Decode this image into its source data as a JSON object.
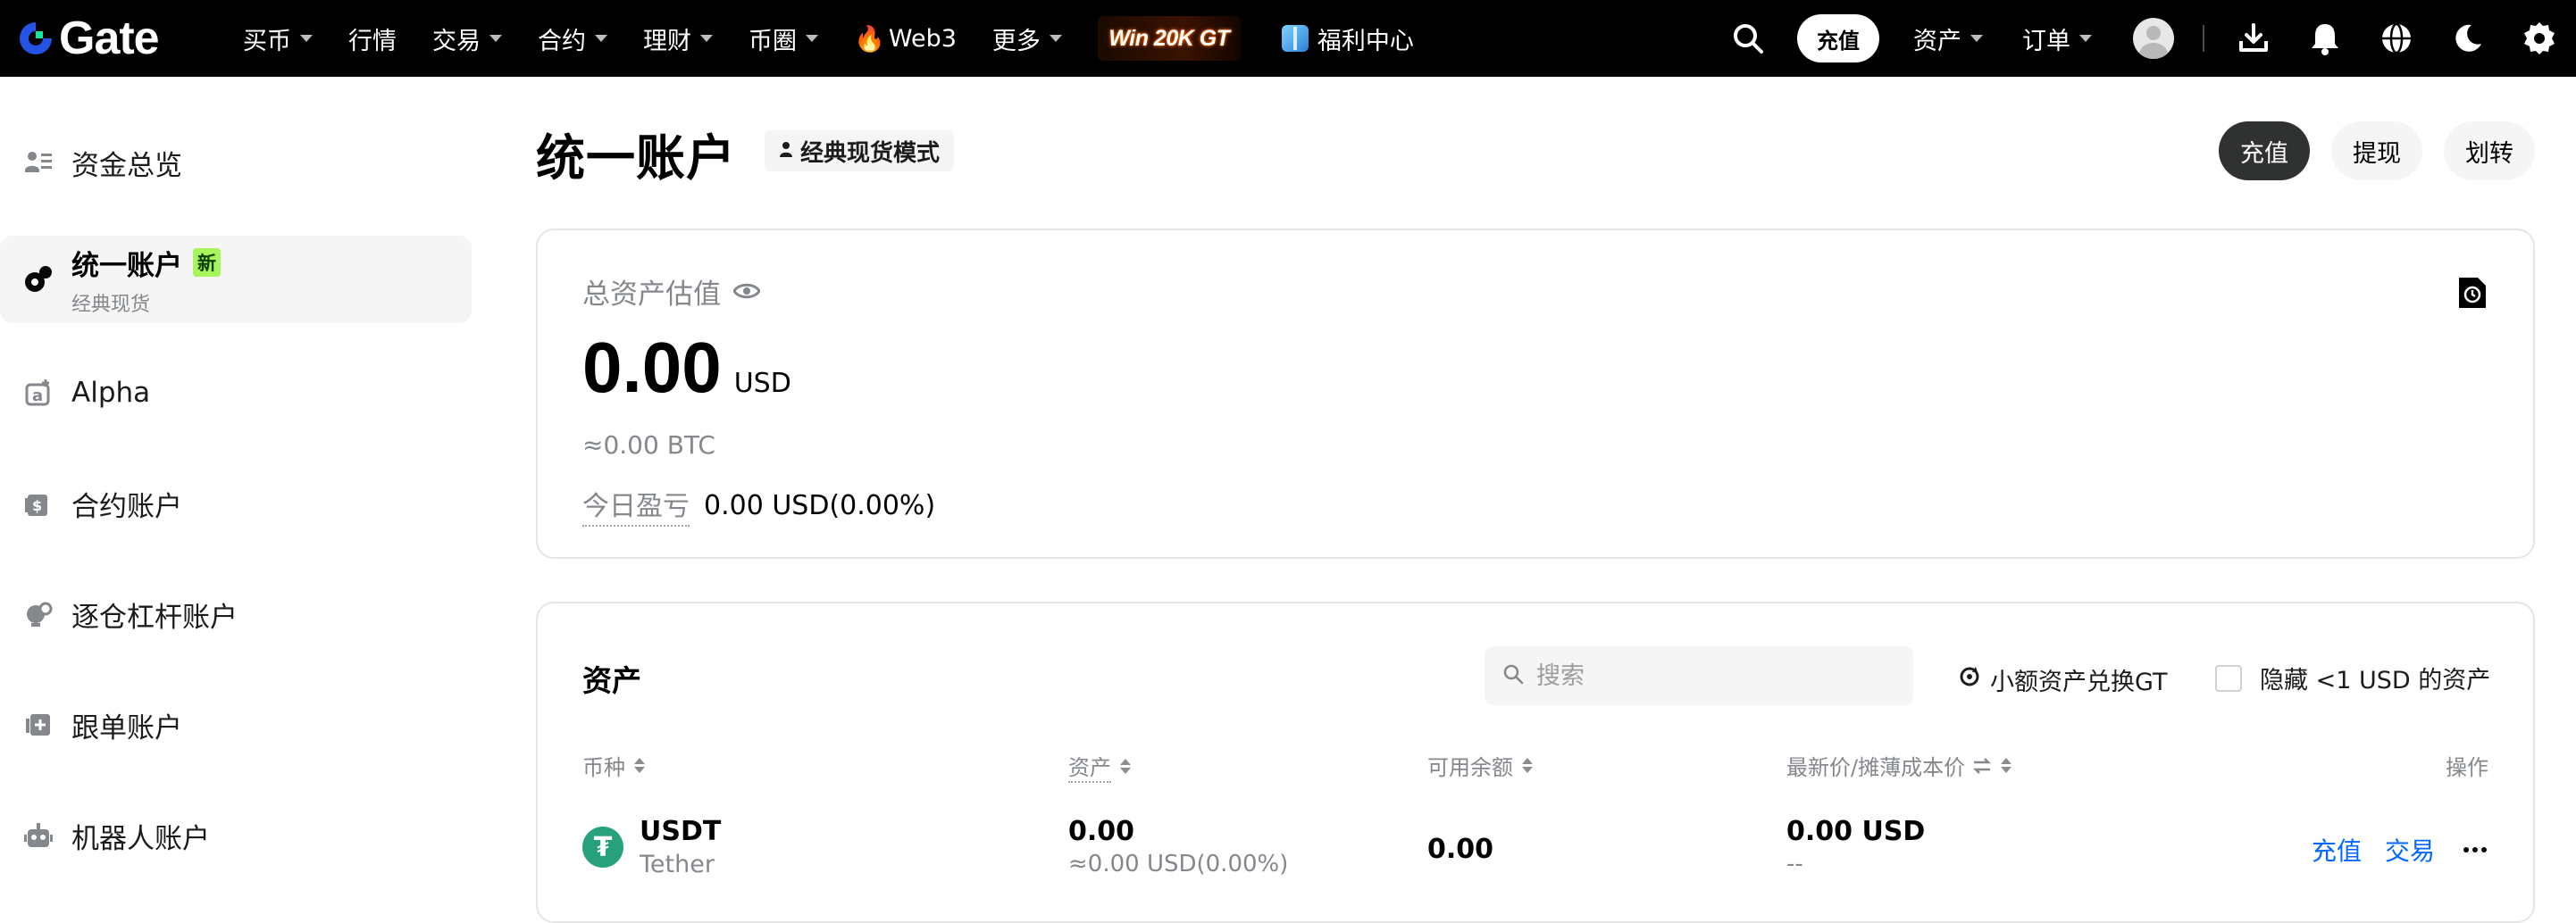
{
  "nav": {
    "logo": "Gate",
    "items": [
      {
        "label": "买币",
        "caret": true
      },
      {
        "label": "行情",
        "caret": false
      },
      {
        "label": "交易",
        "caret": true
      },
      {
        "label": "合约",
        "caret": true
      },
      {
        "label": "理财",
        "caret": true
      },
      {
        "label": "币圈",
        "caret": true
      },
      {
        "label": "Web3",
        "caret": false
      },
      {
        "label": "更多",
        "caret": true
      }
    ],
    "promo": "Win 20K GT",
    "welfare": "福利中心",
    "deposit": "充值",
    "assets": "资产",
    "orders": "订单"
  },
  "sidebar": {
    "items": [
      {
        "label": "资金总览",
        "icon": "fund-overview-icon"
      },
      {
        "label": "统一账户",
        "sub": "经典现货",
        "badge": "新",
        "icon": "unified-account-icon"
      },
      {
        "label": "Alpha",
        "icon": "alpha-icon"
      },
      {
        "label": "合约账户",
        "icon": "futures-account-icon"
      },
      {
        "label": "逐仓杠杆账户",
        "icon": "isolated-margin-icon"
      },
      {
        "label": "跟单账户",
        "icon": "copy-trading-icon"
      },
      {
        "label": "机器人账户",
        "icon": "bot-account-icon"
      }
    ]
  },
  "main": {
    "title": "统一账户",
    "mode_tag": "经典现货模式",
    "actions": [
      "充值",
      "提现",
      "划转"
    ]
  },
  "overview": {
    "label": "总资产估值",
    "amount": "0.00",
    "unit": "USD",
    "btc": "≈0.00 BTC",
    "pnl_label": "今日盈亏",
    "pnl_value": "0.00 USD(0.00%)"
  },
  "assets": {
    "title": "资产",
    "search_placeholder": "搜索",
    "convert": "小额资产兑换GT",
    "hide_small": "隐藏 <1 USD 的资产",
    "columns": [
      "币种",
      "资产",
      "可用余额",
      "最新价/摊薄成本价",
      "操作"
    ],
    "rows": [
      {
        "symbol": "USDT",
        "name": "Tether",
        "asset": "0.00",
        "asset_usd": "≈0.00 USD(0.00%)",
        "available": "0.00",
        "price": "0.00 USD",
        "cost": "--",
        "actions": [
          "充值",
          "交易"
        ]
      }
    ]
  },
  "colors": {
    "accent_blue": "#0068ff",
    "usdt_green": "#26a17b",
    "new_badge": "#a6f55c"
  }
}
